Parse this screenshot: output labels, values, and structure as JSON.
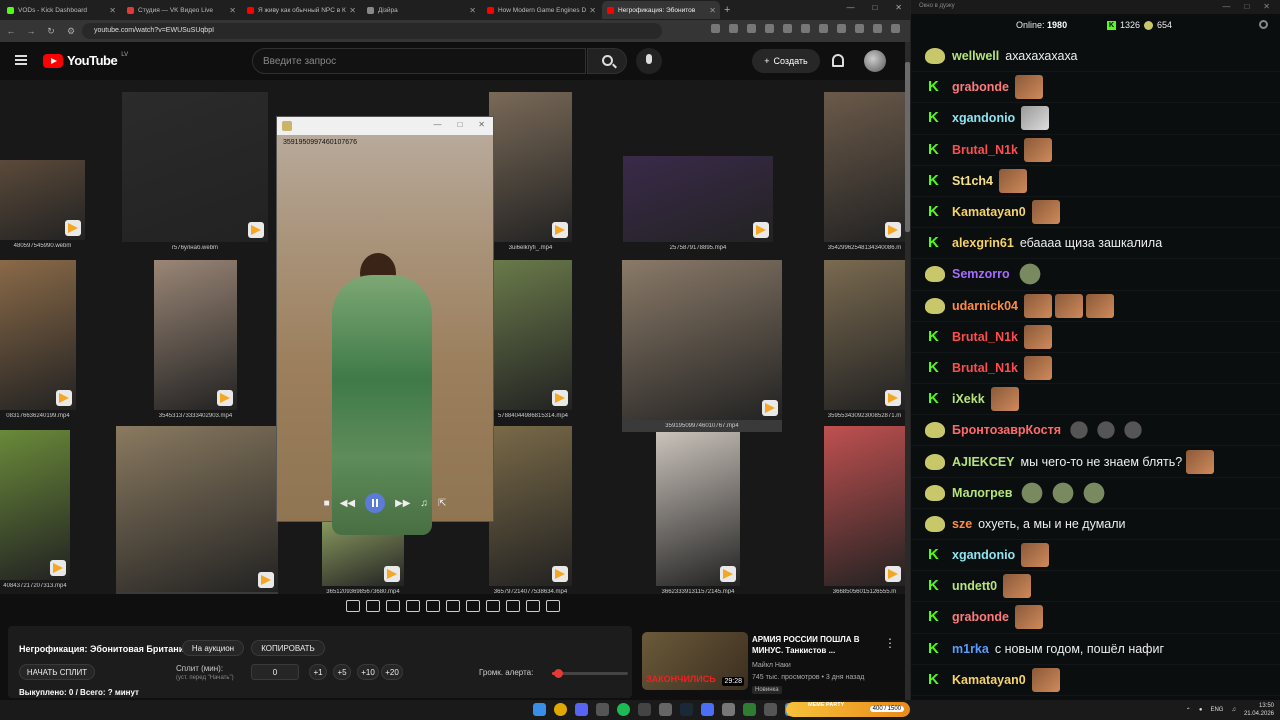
{
  "browser": {
    "tabs": [
      {
        "label": "VODs - Kick Dashboard",
        "color": "#53fc18"
      },
      {
        "label": "Студия — VK Видео Live",
        "color": "#e53935"
      },
      {
        "label": "Я живу как обычный NPC в К",
        "color": "#ff0000"
      },
      {
        "label": "Дізйра",
        "color": "#888888"
      },
      {
        "label": "How Modern Game Engines D",
        "color": "#ff0000"
      },
      {
        "label": "Негрофикация: Эбонитов",
        "color": "#ff0000",
        "active": true
      }
    ],
    "url": "youtube.com/watch?v=EWUSuSUqbpI"
  },
  "youtube": {
    "logo_text": "YouTube",
    "region": "LV",
    "search_placeholder": "Введите запрос",
    "create_label": "Создать"
  },
  "grid": {
    "files": [
      "480597545990.webm",
      "r576улнаб.webm",
      "3ui6elkryfi_.mp4",
      "2575879178895.mp4",
      "35429962548134340086.m",
      "083176636240199.mp4",
      "354531373333402903.mp4",
      "57884044986815314.mp4",
      "359195099746010767.mp4",
      "35955343092300852871.m",
      "408437217207313.mp4",
      "363327973148403750.mp4",
      "365120936985673680.mp4",
      "365797214077538634.mp4",
      "366233391311572145.mp4",
      "36685056015126555.m"
    ],
    "popup_id": "3591950997460107676",
    "popup_watermark": "Make promo:D.JAMG"
  },
  "panel": {
    "title": "Негрофикация: Эбонитовая Британия.",
    "auction_btn": "На аукцион",
    "copy_btn": "КОПИРОВАТЬ",
    "start_btn": "НАЧАТЬ СПЛИТ",
    "split_label": "Сплит (мин):",
    "split_hint": "(уст. перед \"Начать\")",
    "split_value": "0",
    "steps": [
      "+1",
      "+5",
      "+10",
      "+20"
    ],
    "alert_label": "Громк. алерта:",
    "alert_volume": 0.08,
    "sold_text": "Выкуплено: 0 / Всего: ? минут"
  },
  "recommendation": {
    "title": "АРМИЯ РОССИИ ПОШЛА В МИНУС. Танкистов ...",
    "channel": "Майкл Наки",
    "meta": "745 тыс. просмотров • 3 дня назад",
    "badge": "Новинка",
    "duration": "29:28",
    "thumb_text": "ЗАКОНЧИЛИСЬ"
  },
  "chat": {
    "window_title": "Окно в дуэку",
    "online_label": "Online:",
    "online_value": "1980",
    "k_count": "1326",
    "pepe_count": "654",
    "messages": [
      {
        "badge": "pepe",
        "user": "wellwell",
        "color": "#b6e37a",
        "text": "ахахахахаха",
        "emotes": []
      },
      {
        "badge": "k",
        "user": "grabonde",
        "color": "#ff7b7b",
        "text": "",
        "emotes": [
          "face"
        ]
      },
      {
        "badge": "k",
        "user": "xgandonio",
        "color": "#8fe3f0",
        "text": "",
        "emotes": [
          "cat"
        ]
      },
      {
        "badge": "k",
        "user": "Brutal_N1k",
        "color": "#ff4d4d",
        "text": "",
        "emotes": [
          "face"
        ]
      },
      {
        "badge": "k",
        "user": "St1ch4",
        "color": "#f5e08a",
        "text": "",
        "emotes": [
          "face"
        ]
      },
      {
        "badge": "k",
        "user": "Kamatayan0",
        "color": "#f5d36a",
        "text": "",
        "emotes": [
          "face"
        ]
      },
      {
        "badge": "k",
        "user": "alexgrin61",
        "color": "#f5d36a",
        "text": "ебаааа щиза зашкалила",
        "emotes": []
      },
      {
        "badge": "pepe",
        "user": "Semzorro",
        "color": "#a46cff",
        "text": "",
        "emotes": [
          "green"
        ]
      },
      {
        "badge": "pepe",
        "user": "udarnick04",
        "color": "#ff8c42",
        "text": "",
        "emotes": [
          "face",
          "face",
          "face"
        ]
      },
      {
        "badge": "k",
        "user": "Brutal_N1k",
        "color": "#ff4d4d",
        "text": "",
        "emotes": [
          "face"
        ]
      },
      {
        "badge": "k",
        "user": "Brutal_N1k",
        "color": "#ff4d4d",
        "text": "",
        "emotes": [
          "face"
        ]
      },
      {
        "badge": "k",
        "user": "iXekk",
        "color": "#b6e37a",
        "text": "",
        "emotes": [
          "face"
        ]
      },
      {
        "badge": "pepe",
        "user": "БронтозаврКостя",
        "color": "#ff6b6b",
        "text": "",
        "emotes": [
          "ball",
          "ball",
          "ball"
        ]
      },
      {
        "badge": "pepe",
        "user": "AJIEKCEY",
        "color": "#b6e37a",
        "text": "мы чего-то не знаем блять?",
        "emotes": [
          "face"
        ]
      },
      {
        "badge": "pepe",
        "user": "Малогрев",
        "color": "#b6e37a",
        "text": "",
        "emotes": [
          "green",
          "green",
          "green"
        ]
      },
      {
        "badge": "pepe",
        "user": "sze",
        "color": "#ff8c42",
        "text": "охуеть, а мы и не думали",
        "emotes": []
      },
      {
        "badge": "k",
        "user": "xgandonio",
        "color": "#8fe3f0",
        "text": "",
        "emotes": [
          "face"
        ]
      },
      {
        "badge": "k",
        "user": "undett0",
        "color": "#b6e37a",
        "text": "",
        "emotes": [
          "face"
        ]
      },
      {
        "badge": "k",
        "user": "grabonde",
        "color": "#ff7b7b",
        "text": "",
        "emotes": [
          "face"
        ]
      },
      {
        "badge": "k",
        "user": "m1rka",
        "color": "#5b9cff",
        "text": "с новым годом, пошёл нафиг",
        "emotes": []
      },
      {
        "badge": "k",
        "user": "Kamatayan0",
        "color": "#f5d36a",
        "text": "",
        "emotes": [
          "face"
        ]
      }
    ]
  },
  "taskbar": {
    "meme_label": "MEME PARTY",
    "meme_count": "400 / 1500",
    "lang": "ENG",
    "time": "13:50",
    "date": "21.04.2026"
  }
}
